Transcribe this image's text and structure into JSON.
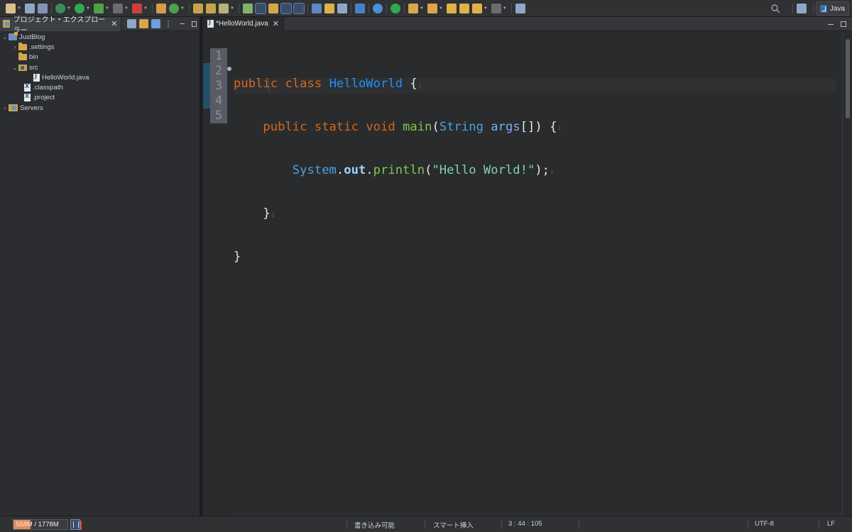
{
  "perspective": {
    "label": "Java"
  },
  "left_view": {
    "tab_label": "プロジェクト・エクスプローラー",
    "tree": [
      {
        "label": "JustBlog",
        "level": 0,
        "expanded": true,
        "icon": "project-icon"
      },
      {
        "label": ".settings",
        "level": 1,
        "expanded": false,
        "icon": "folder-icon"
      },
      {
        "label": "bin",
        "level": 1,
        "expanded": null,
        "icon": "folder-icon"
      },
      {
        "label": "src",
        "level": 1,
        "expanded": true,
        "icon": "source-folder-icon"
      },
      {
        "label": "HelloWorld.java",
        "level": 2,
        "expanded": null,
        "icon": "java-file-icon"
      },
      {
        "label": ".classpath",
        "level": 1,
        "expanded": null,
        "icon": "xml-file-icon"
      },
      {
        "label": ".project",
        "level": 1,
        "expanded": null,
        "icon": "xml-file-icon"
      },
      {
        "label": "Servers",
        "level": 0,
        "expanded": false,
        "icon": "server-folder-icon"
      }
    ]
  },
  "editor": {
    "tab_label": "*HelloWorld.java",
    "line_numbers": [
      "1",
      "2",
      "3",
      "4",
      "5"
    ],
    "code": {
      "l1": {
        "kw1": "public",
        "kw2": "class",
        "name": "HelloWorld",
        "brace": "{"
      },
      "l2": {
        "kw1": "public",
        "kw2": "static",
        "kw3": "void",
        "method": "main",
        "open": "(",
        "type": "String",
        "param": "args",
        "close": "[]) {"
      },
      "l3": {
        "cls": "System",
        "dot1": ".",
        "field": "out",
        "dot2": ".",
        "method": "println",
        "open": "(",
        "str": "\"Hello World!\"",
        "close": ");"
      },
      "l4": {
        "brace": "}"
      },
      "l5": {
        "brace": "}"
      },
      "eol_marker": "↓"
    }
  },
  "status": {
    "heap_used": "558M",
    "heap_total": "1778M",
    "heap_fraction": 0.31,
    "writable": "書き込み可能",
    "insert_mode": "スマート挿入",
    "position": "3 : 44 : 105",
    "encoding": "UTF-8",
    "line_delimiter": "LF"
  },
  "colors": {
    "keyword": "#d2691e",
    "class": "#1e90ff",
    "method": "#7ec850",
    "string": "#7fd1b3",
    "heap_fill": "#e08a5a"
  }
}
